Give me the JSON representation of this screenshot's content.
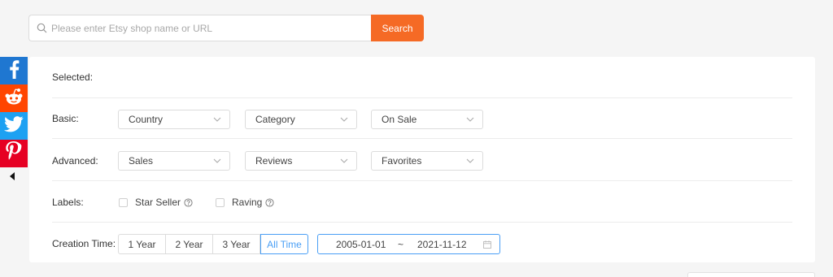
{
  "search": {
    "placeholder": "Please enter Etsy shop name or URL",
    "button_label": "Search",
    "accent_color": "#f56a25"
  },
  "social": {
    "items": [
      {
        "name": "facebook-icon",
        "color": "#1f77d1"
      },
      {
        "name": "reddit-icon",
        "color": "#ff4500"
      },
      {
        "name": "twitter-icon",
        "color": "#1da1f2"
      },
      {
        "name": "pinterest-icon",
        "color": "#e60023"
      }
    ]
  },
  "filters": {
    "selected_label": "Selected:",
    "basic": {
      "label": "Basic:",
      "selects": [
        "Country",
        "Category",
        "On Sale"
      ]
    },
    "advanced": {
      "label": "Advanced:",
      "selects": [
        "Sales",
        "Reviews",
        "Favorites"
      ]
    },
    "labels": {
      "label": "Labels:",
      "options": [
        "Star Seller",
        "Raving"
      ]
    },
    "creation_time": {
      "label": "Creation Time:",
      "options": [
        "1 Year",
        "2 Year",
        "3 Year",
        "All Time"
      ],
      "active": "All Time",
      "date_from": "2005-01-01",
      "separator": "~",
      "date_to": "2021-11-12"
    },
    "highlight_color": "#4a9ff5"
  }
}
